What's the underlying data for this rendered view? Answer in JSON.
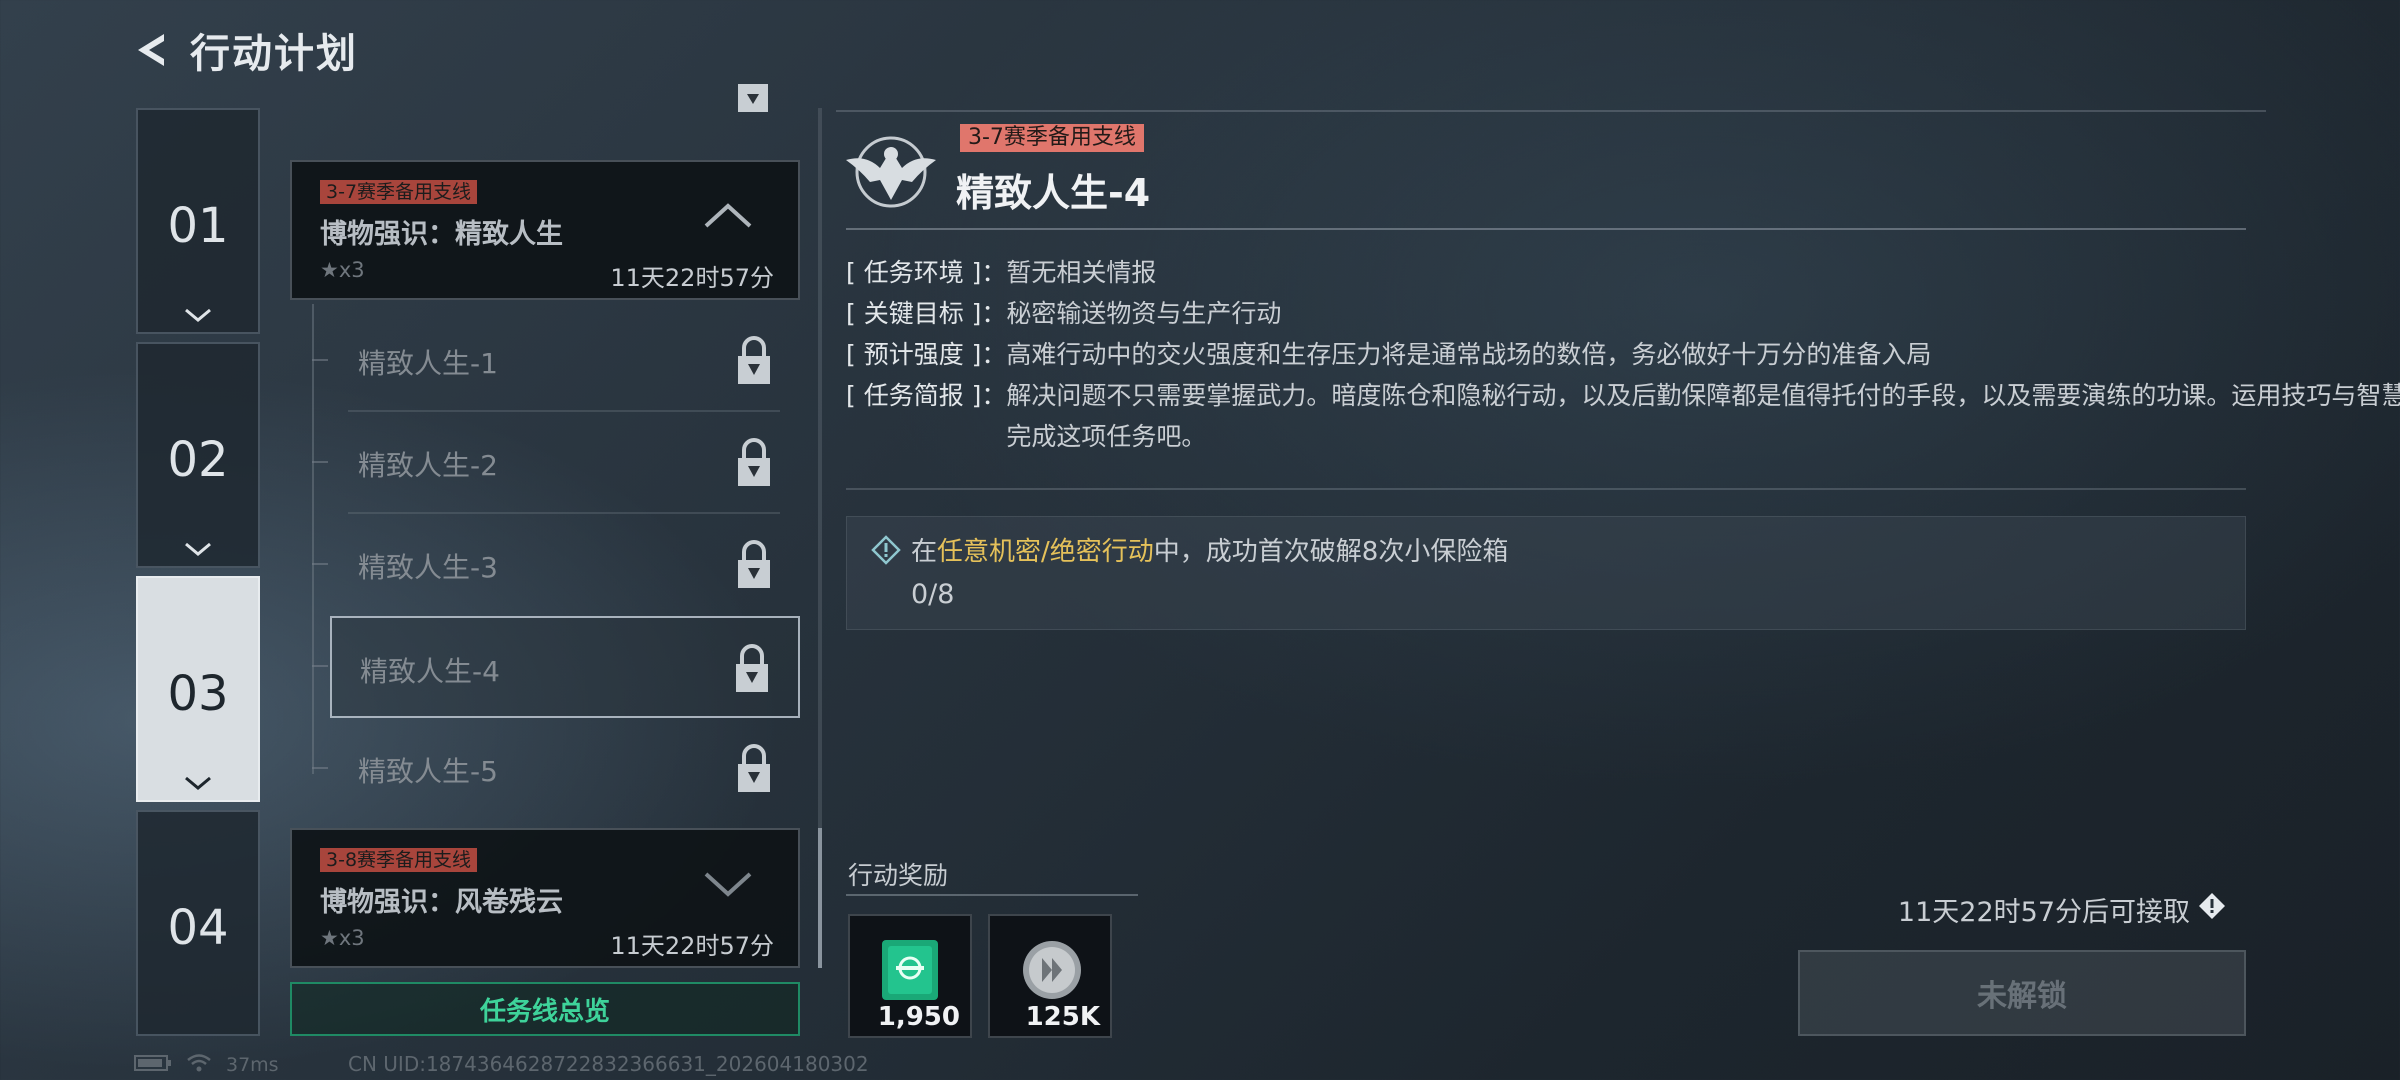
{
  "header": {
    "title": "行动计划"
  },
  "chapters": [
    {
      "num": "01"
    },
    {
      "num": "02"
    },
    {
      "num": "03"
    },
    {
      "num": "04"
    }
  ],
  "missions": {
    "top_partial": "...",
    "current": {
      "tag": "3-7赛季备用支线",
      "title": "博物强识：精致人生",
      "stars": "★x3",
      "time": "11天22时57分"
    },
    "sub_items": [
      {
        "label": "精致人生-1"
      },
      {
        "label": "精致人生-2"
      },
      {
        "label": "精致人生-3"
      },
      {
        "label": "精致人生-4"
      },
      {
        "label": "精致人生-5"
      }
    ],
    "next": {
      "tag": "3-8赛季备用支线",
      "title": "博物强识：风卷残云",
      "stars": "★x3",
      "time": "11天22时57分"
    },
    "overview_label": "任务线总览"
  },
  "detail": {
    "tag": "3-7赛季备用支线",
    "title": "精致人生-4",
    "info": [
      {
        "key": "[ 任务环境 ]：",
        "value": "暂无相关情报"
      },
      {
        "key": "[ 关键目标 ]：",
        "value": "秘密输送物资与生产行动"
      },
      {
        "key": "[ 预计强度 ]：",
        "value": "高难行动中的交火强度和生存压力将是通常战场的数倍，务必做好十万分的准备入局"
      },
      {
        "key": "[ 任务简报 ]：",
        "value": "解决问题不只需要掌握武力。暗度陈仓和隐秘行动，以及后勤保障都是值得托付的手段，以及需要演练的功课。运用技巧与智慧完成这项任务吧。"
      }
    ],
    "objective": {
      "prefix": "在",
      "highlight": "任意机密/绝密行动",
      "suffix": "中，成功首次破解8次小保险箱",
      "progress": "0/8",
      "highlight_color": "#e5c15a"
    },
    "reward_label": "行动奖励",
    "rewards": [
      {
        "icon": "green-card-icon",
        "qty": "1,950"
      },
      {
        "icon": "silver-coin-icon",
        "qty": "125K"
      }
    ],
    "available_text": "11天22时57分后可接取",
    "locked_label": "未解锁"
  },
  "status_bar": {
    "ping": "37ms",
    "uid": "CN UID:1874364628722832366631_202604180302"
  },
  "colors": {
    "accent_green": "#3ed39a",
    "tag_red": "#e0766c",
    "highlight_yellow": "#e5c15a"
  }
}
